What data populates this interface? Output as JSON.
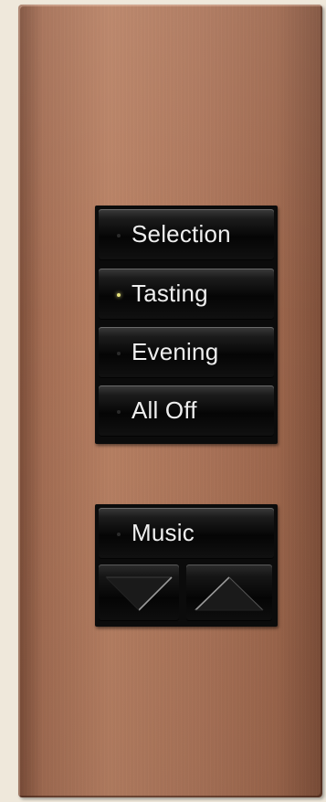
{
  "keypad": {
    "scenes": [
      {
        "label": "Selection",
        "led_on": false
      },
      {
        "label": "Tasting",
        "led_on": true
      },
      {
        "label": "Evening",
        "led_on": false
      },
      {
        "label": "All Off",
        "led_on": false
      }
    ],
    "music": {
      "label": "Music",
      "lower_icon": "lower-icon",
      "raise_icon": "raise-icon"
    }
  },
  "colors": {
    "faceplate": "#b07658",
    "background": "#efe8db",
    "button": "#0b0b0b",
    "label": "#eeeeee",
    "led_active": "#e6e27a"
  }
}
